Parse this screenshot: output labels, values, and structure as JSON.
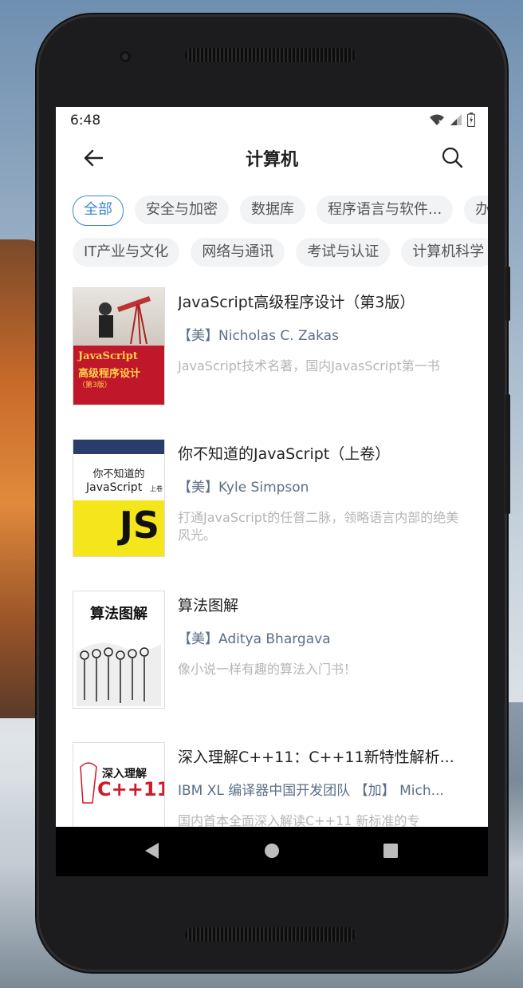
{
  "status": {
    "time": "6:48"
  },
  "appbar": {
    "title": "计算机",
    "back_icon": "arrow-left-icon",
    "search_icon": "search-icon"
  },
  "categories": {
    "row1": [
      {
        "label": "全部",
        "active": true
      },
      {
        "label": "安全与加密",
        "active": false
      },
      {
        "label": "数据库",
        "active": false
      },
      {
        "label": "程序语言与软件...",
        "active": false
      },
      {
        "label": "办",
        "active": false
      }
    ],
    "row2": [
      {
        "label": "IT产业与文化",
        "active": false
      },
      {
        "label": "网络与通讯",
        "active": false
      },
      {
        "label": "考试与认证",
        "active": false
      },
      {
        "label": "计算机科学",
        "active": false
      }
    ]
  },
  "books": [
    {
      "title": "JavaScript高级程序设计（第3版）",
      "author": "【美】Nicholas C. Zakas",
      "desc": "JavaScript技术名著，国内JavasScript第一书",
      "cover": {
        "main": "JavaScript",
        "sub": "高级程序设计",
        "edition": "（第3版）",
        "bg": "#c0172a"
      }
    },
    {
      "title": "你不知道的JavaScript（上卷）",
      "author": "【美】Kyle Simpson",
      "desc": "打通JavaScript的任督二脉，领略语言内部的绝美风光。",
      "cover": {
        "main": "你不知道的",
        "sub": "JavaScript",
        "vol": "上卷",
        "logo": "JS",
        "bg": "#f5e61c"
      }
    },
    {
      "title": "算法图解",
      "author": "【美】Aditya Bhargava",
      "desc": "像小说一样有趣的算法入门书！",
      "cover": {
        "main": "算法图解",
        "bg": "#ffffff"
      }
    },
    {
      "title": "深入理解C++11：C++11新特性解析...",
      "author": "IBM XL 编译器中国开发团队 【加】 Mich...",
      "desc": "国内首本全面深入解读C++11 新标准的专",
      "cover": {
        "main": "深入理解",
        "sub": "C++11",
        "bg": "#ffffff"
      }
    }
  ],
  "colors": {
    "accent": "#3d86d8",
    "author": "#5b6f86",
    "desc": "#b5b5b5"
  }
}
